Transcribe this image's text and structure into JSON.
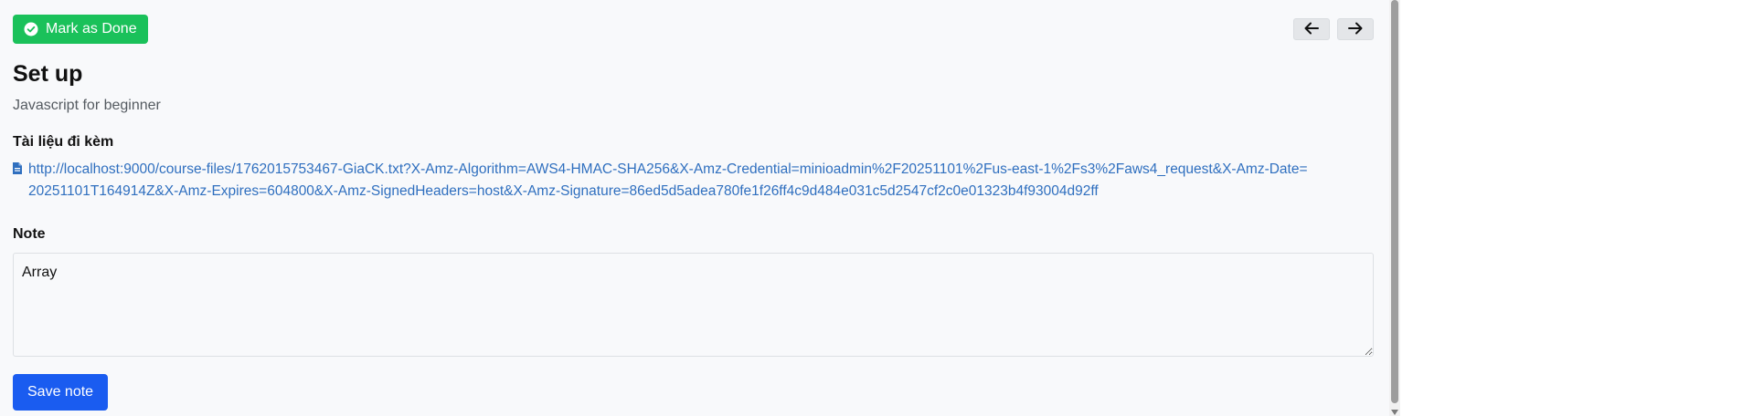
{
  "toolbar": {
    "mark_done_label": "Mark as Done",
    "mark_done_icon": "check-circle-icon",
    "prev_icon": "arrow-left-icon",
    "next_icon": "arrow-right-icon"
  },
  "lesson": {
    "title": "Set up",
    "course": "Javascript for beginner"
  },
  "attachments": {
    "label": "Tài liệu đi kèm",
    "items": [
      {
        "icon": "file-icon",
        "url": "http://localhost:9000/course-files/1762015753467-GiaCK.txt?X-Amz-Algorithm=AWS4-HMAC-SHA256&X-Amz-Credential=minioadmin%2F20251101%2Fus-east-1%2Fs3%2Faws4_request&X-Amz-Date=20251101T164914Z&X-Amz-Expires=604800&X-Amz-SignedHeaders=host&X-Amz-Signature=86ed5d5adea780fe1f26ff4c9d484e031c5d2547cf2c0e01323b4f93004d92ff"
      }
    ]
  },
  "note": {
    "label": "Note",
    "value": "Array",
    "save_label": "Save note"
  },
  "colors": {
    "done_button": "#1ac15a",
    "save_button": "#1a5cf0",
    "link": "#2f6fbf"
  }
}
